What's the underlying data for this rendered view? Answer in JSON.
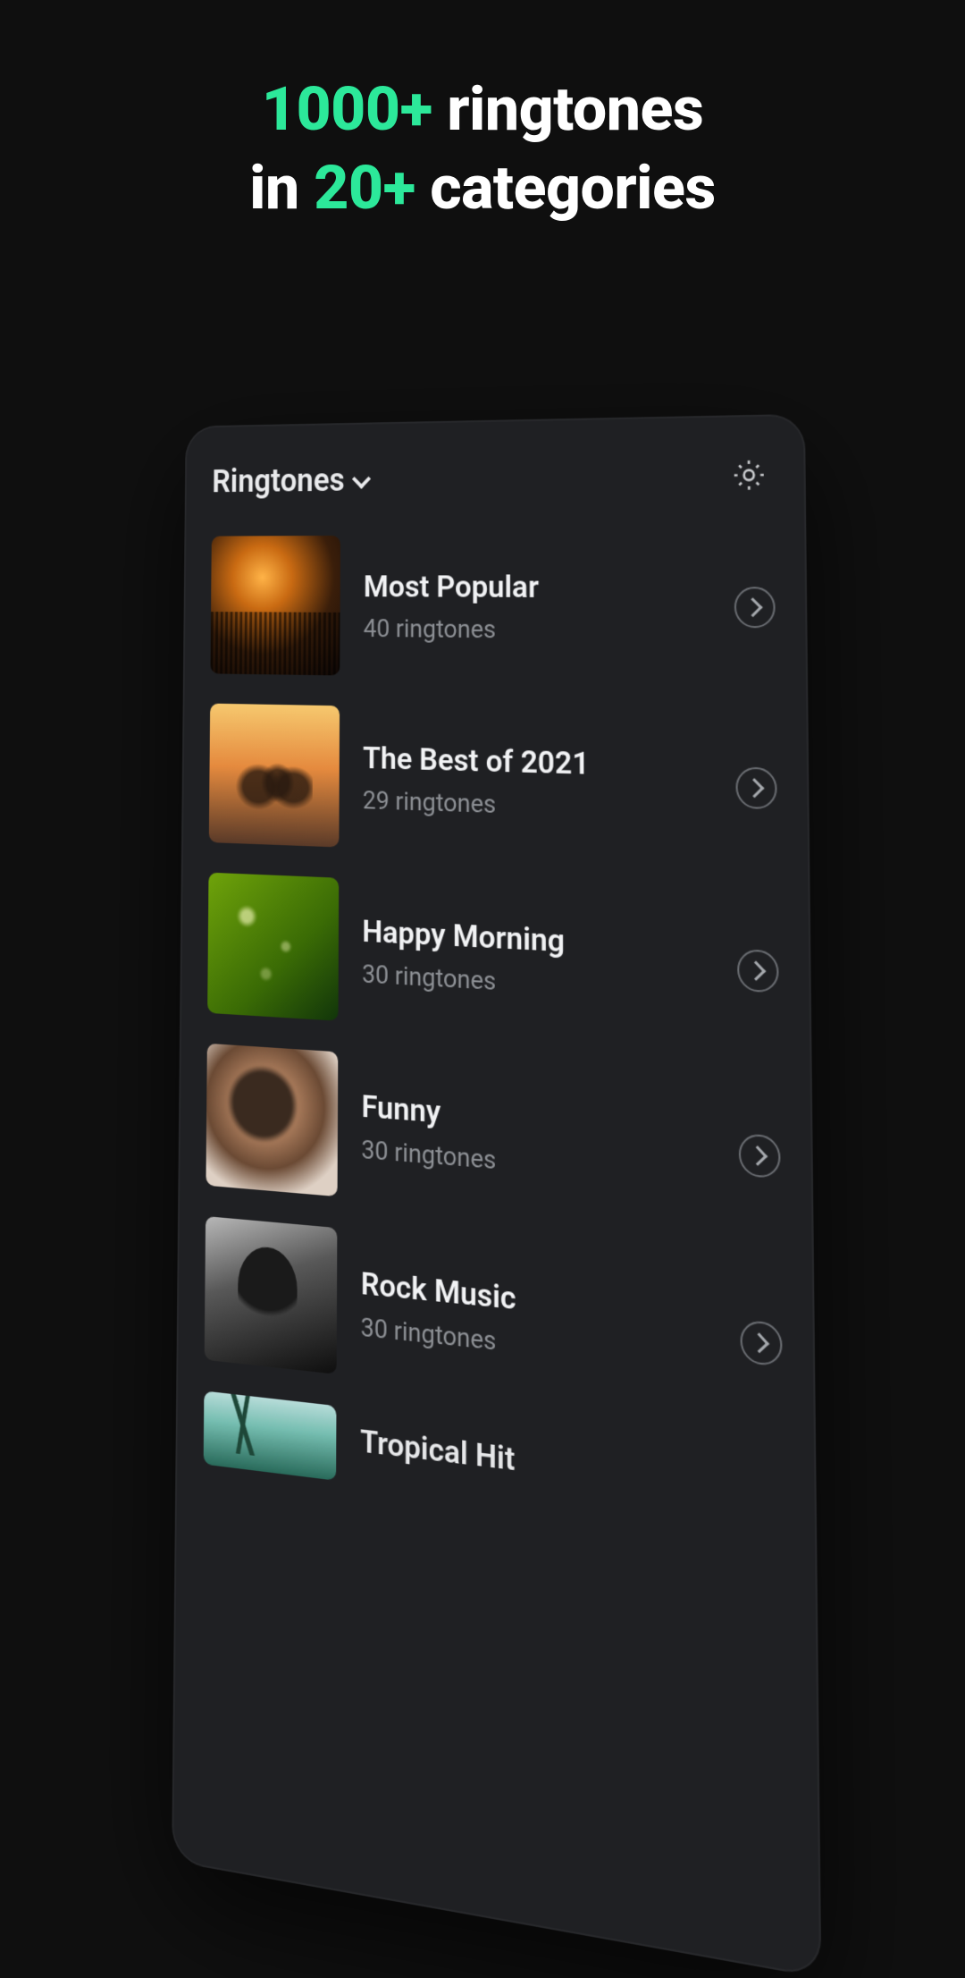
{
  "promo": {
    "part1": "1000+",
    "part2": " ringtones",
    "part3": "in ",
    "part4": "20+",
    "part5": " categories"
  },
  "header": {
    "title": "Ringtones",
    "settings_icon": "gear-icon"
  },
  "categories": [
    {
      "title": "Most Popular",
      "subtitle": "40 ringtones",
      "thumb": "concert"
    },
    {
      "title": "The Best of 2021",
      "subtitle": "29 ringtones",
      "thumb": "sunset"
    },
    {
      "title": "Happy Morning",
      "subtitle": "30 ringtones",
      "thumb": "grass"
    },
    {
      "title": "Funny",
      "subtitle": "30 ringtones",
      "thumb": "portrait"
    },
    {
      "title": "Rock Music",
      "subtitle": "30 ringtones",
      "thumb": "rock"
    },
    {
      "title": "Tropical Hit",
      "subtitle": "",
      "thumb": "tropical"
    }
  ],
  "colors": {
    "accent": "#2ce89a",
    "bg": "#0f0f0f",
    "device": "#1f2023"
  }
}
